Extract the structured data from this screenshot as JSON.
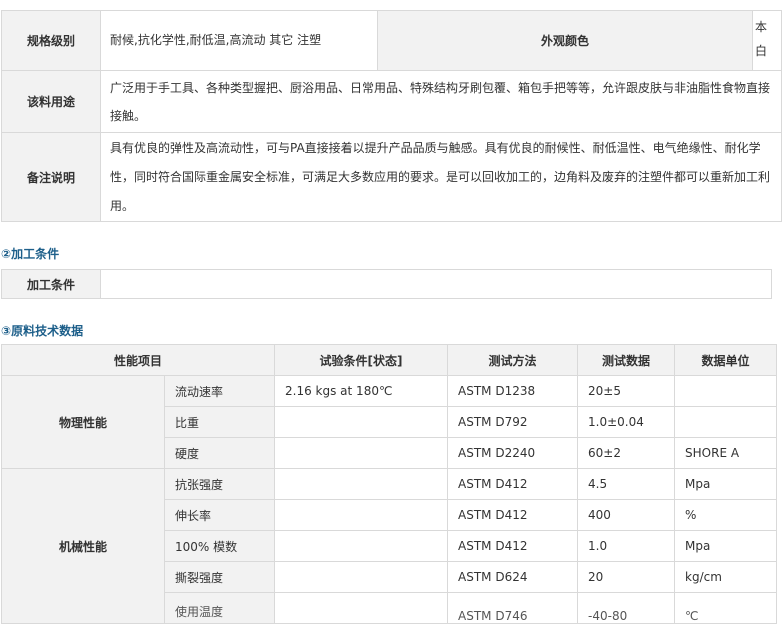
{
  "info": {
    "grade_label": "规格级别",
    "grade_value": "耐候,抗化学性,耐低温,高流动 其它 注塑",
    "color_label": "外观颜色",
    "color_value": "本白",
    "use_label": "该料用途",
    "use_value": "广泛用于手工具、各种类型握把、厨浴用品、日常用品、特殊结构牙刷包覆、箱包手把等等，允许跟皮肤与非油脂性食物直接接触。",
    "note_label": "备注说明",
    "note_value": "具有优良的弹性及高流动性，可与PA直接接着以提升产品品质与触感。具有优良的耐候性、耐低温性、电气绝缘性、耐化学性，同时符合国际重金属安全标准，可满足大多数应用的要求。是可以回收加工的，边角料及废弃的注塑件都可以重新加工利用。"
  },
  "processing": {
    "section_title": "②加工条件",
    "label": "加工条件",
    "value": ""
  },
  "tech": {
    "section_title": "③原料技术数据",
    "headers": [
      "性能项目",
      "试验条件[状态]",
      "测试方法",
      "测试数据",
      "数据单位"
    ],
    "groups": [
      {
        "name": "物理性能",
        "rows": [
          {
            "property": "流动速率",
            "condition": "2.16 kgs at 180℃",
            "method": "ASTM D1238",
            "value": "20±5",
            "unit": ""
          },
          {
            "property": "比重",
            "condition": "",
            "method": "ASTM D792",
            "value": "1.0±0.04",
            "unit": ""
          },
          {
            "property": "硬度",
            "condition": "",
            "method": "ASTM D2240",
            "value": "60±2",
            "unit": "SHORE A"
          }
        ]
      },
      {
        "name": "机械性能",
        "rows": [
          {
            "property": "抗张强度",
            "condition": "",
            "method": "ASTM D412",
            "value": "4.5",
            "unit": "Mpa"
          },
          {
            "property": "伸长率",
            "condition": "",
            "method": "ASTM D412",
            "value": "400",
            "unit": "%"
          },
          {
            "property": "100% 模数",
            "condition": "",
            "method": "ASTM D412",
            "value": "1.0",
            "unit": "Mpa"
          },
          {
            "property": "撕裂强度",
            "condition": "",
            "method": "ASTM D624",
            "value": "20",
            "unit": "kg/cm"
          },
          {
            "property": "使用温度",
            "condition": "",
            "method": "ASTM D746",
            "value": "-40-80",
            "unit": "℃"
          }
        ]
      }
    ]
  }
}
